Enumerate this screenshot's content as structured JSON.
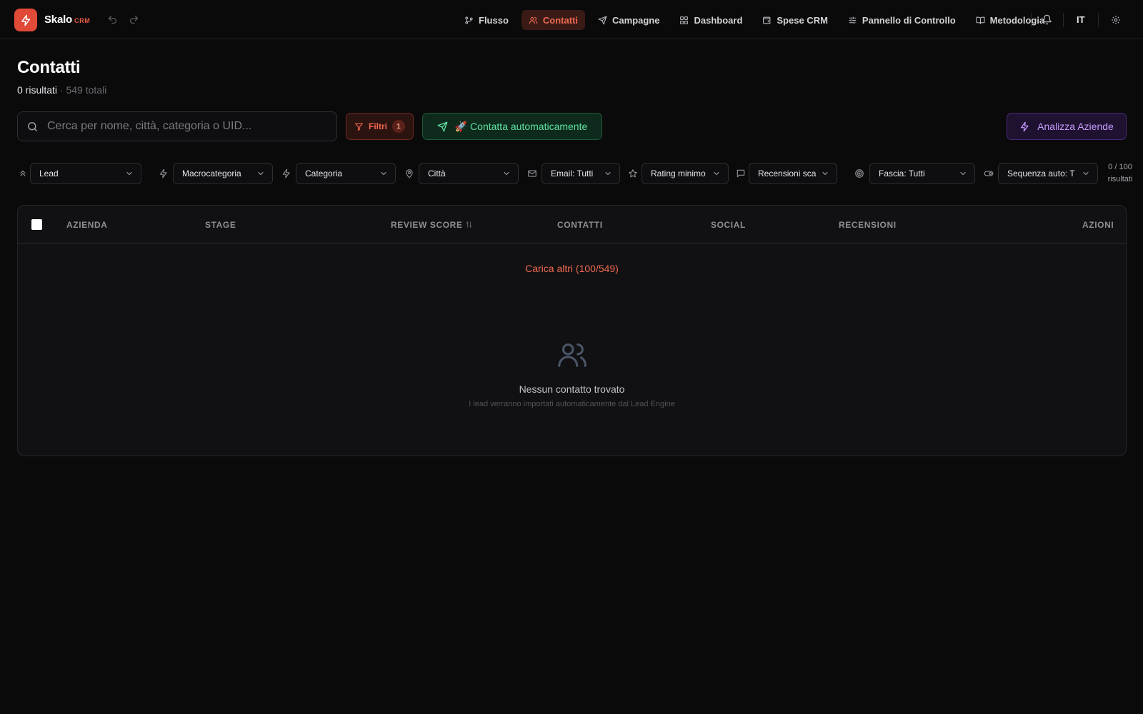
{
  "brand": {
    "name": "Skalo",
    "tag": "CRM"
  },
  "nav": {
    "items": [
      {
        "label": "Flusso",
        "icon": "git-branch-icon"
      },
      {
        "label": "Contatti",
        "icon": "users-icon",
        "active": true
      },
      {
        "label": "Campagne",
        "icon": "send-icon"
      },
      {
        "label": "Dashboard",
        "icon": "layout-grid-icon"
      },
      {
        "label": "Spese CRM",
        "icon": "wallet-icon"
      },
      {
        "label": "Pannello di Controllo",
        "icon": "sliders-icon"
      },
      {
        "label": "Metodologia",
        "icon": "book-open-icon"
      }
    ],
    "language": "IT"
  },
  "page": {
    "title": "Contatti",
    "results": "0 risultati",
    "separator": "·",
    "total": "549 totali"
  },
  "toolbar": {
    "search_placeholder": "Cerca per nome, città, categoria o UID...",
    "search_value": "",
    "filters_label": "Filtri",
    "filters_count": "1",
    "auto_contact_label": "🚀 Contatta automaticamente",
    "analyze_label": "Analizza Aziende"
  },
  "filters": [
    {
      "value": "Lead",
      "icon": "chevrons-up-icon"
    },
    {
      "value": "Macrocategoria",
      "icon": "zap-icon"
    },
    {
      "value": "Categoria",
      "icon": "zap-icon"
    },
    {
      "value": "Città",
      "icon": "map-pin-icon"
    },
    {
      "value": "Email: Tutti",
      "icon": "mail-icon"
    },
    {
      "value": "Rating minimo",
      "icon": "star-icon"
    },
    {
      "value": "Recensioni sca",
      "icon": "message-square-icon"
    },
    {
      "value": "Fascia: Tutti",
      "icon": "target-icon"
    },
    {
      "value": "Sequenza auto: T",
      "icon": "toggle-icon"
    }
  ],
  "result_count": {
    "line1": "0 / 100",
    "line2": "risultati"
  },
  "table": {
    "columns": [
      "AZIENDA",
      "STAGE",
      "REVIEW SCORE",
      "CONTATTI",
      "SOCIAL",
      "RECENSIONI",
      "AZIONI"
    ],
    "load_more": "Carica altri (100/549)",
    "empty_title": "Nessun contatto trovato",
    "empty_subtitle": "I lead verranno importati automaticamente dal Lead Engine"
  },
  "colors": {
    "accent": "#e04a36",
    "active_nav_bg": "#3a1a15",
    "green": "#5fe1a0",
    "purple": "#c89bff",
    "background": "#0a0a0a"
  }
}
